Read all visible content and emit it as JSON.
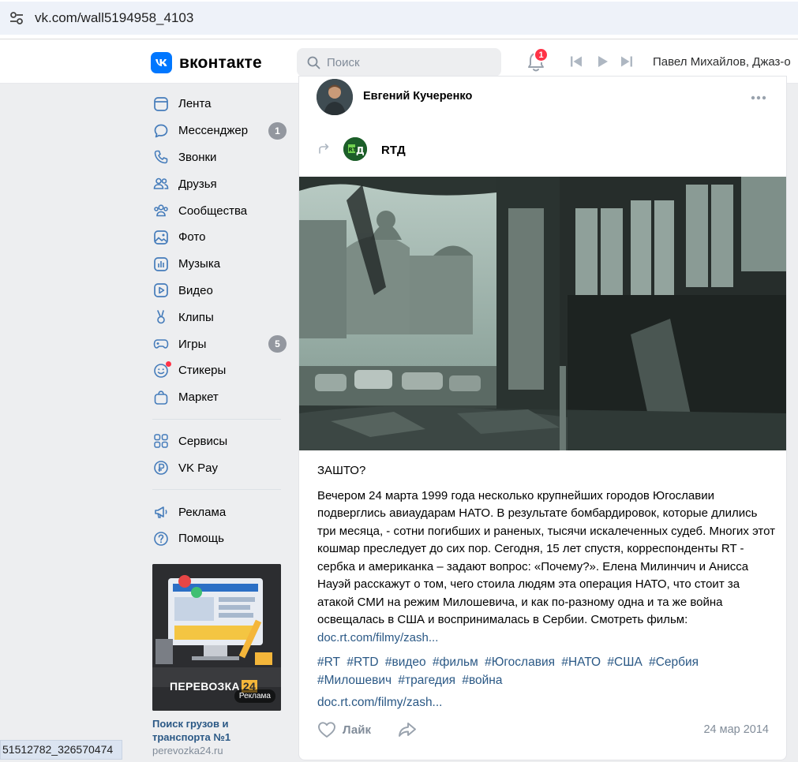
{
  "browser": {
    "url": "vk.com/wall5194958_4103"
  },
  "header": {
    "logo_text": "вконтакте",
    "search_placeholder": "Поиск",
    "notifications_count": "1",
    "player_track": "Павел Михайлов, Джаз-о"
  },
  "sidebar": {
    "items": [
      {
        "label": "Лента",
        "icon": "feed-icon"
      },
      {
        "label": "Мессенджер",
        "icon": "chat-icon",
        "count": "1"
      },
      {
        "label": "Звонки",
        "icon": "phone-icon"
      },
      {
        "label": "Друзья",
        "icon": "friends-icon"
      },
      {
        "label": "Сообщества",
        "icon": "community-icon"
      },
      {
        "label": "Фото",
        "icon": "photo-icon"
      },
      {
        "label": "Музыка",
        "icon": "music-icon"
      },
      {
        "label": "Видео",
        "icon": "video-icon"
      },
      {
        "label": "Клипы",
        "icon": "clips-icon"
      },
      {
        "label": "Игры",
        "icon": "games-icon",
        "count": "5"
      },
      {
        "label": "Стикеры",
        "icon": "stickers-icon"
      },
      {
        "label": "Маркет",
        "icon": "market-icon"
      }
    ],
    "items2": [
      {
        "label": "Сервисы",
        "icon": "services-icon"
      },
      {
        "label": "VK Pay",
        "icon": "vkpay-icon"
      }
    ],
    "items3": [
      {
        "label": "Реклама",
        "icon": "ads-icon"
      },
      {
        "label": "Помощь",
        "icon": "help-icon"
      }
    ],
    "ad": {
      "image_brand": "ПЕРЕВОЗКА",
      "image_brand_num": "24",
      "image_tag": "Реклама",
      "title": "Поиск грузов и транспорта №1",
      "domain": "perevozka24.ru"
    }
  },
  "post": {
    "author": "Евгений Кучеренко",
    "repost_source": "RTД",
    "heading": "ЗАШТО?",
    "body": "Вечером 24 марта 1999 года несколько крупнейших городов Югославии подверглись авиаударам НАТО. В результате бомбардировок, которые длились три месяца, - сотни погибших и раненых, тысячи искалеченных судеб. Многих этот кошмар преследует до сих пор. Сегодня, 15 лет спустя, корреспонденты RT - сербка и американка – задают вопрос: «Почему?». Елена Милинчич и Анисса Науэй расскажут о том, чего стоила людям эта операция НАТО, что стоит за атакой СМИ на режим Милошевича, и как по-разному одна и та же война освещалась в США и воспринималась в Сербии. Смотреть фильм: ",
    "body_link": "doc.rt.com/filmy/zash...",
    "hashtags": [
      "#RT",
      "#RTD",
      "#видео",
      "#фильм",
      "#Югославия",
      "#НАТО",
      "#США",
      "#Сербия",
      "#Милошевич",
      "#трагедия",
      "#война"
    ],
    "link": "doc.rt.com/filmy/zash...",
    "like_label": "Лайк",
    "date": "24 мар 2014"
  },
  "statusbar": {
    "text": "51512782_326570474"
  }
}
